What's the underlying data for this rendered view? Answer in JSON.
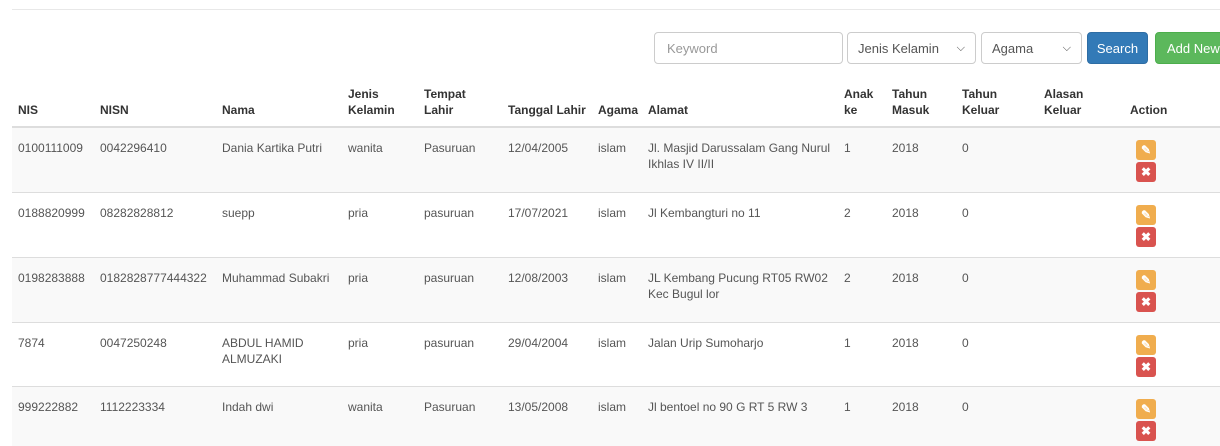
{
  "toolbar": {
    "keyword_placeholder": "Keyword",
    "jenis_kelamin_label": "Jenis Kelamin",
    "agama_label": "Agama",
    "search_label": "Search",
    "add_new_label": "Add New"
  },
  "table": {
    "headers": [
      "NIS",
      "NISN",
      "Nama",
      "Jenis Kelamin",
      "Tempat Lahir",
      "Tanggal Lahir",
      "Agama",
      "Alamat",
      "Anak ke",
      "Tahun Masuk",
      "Tahun Keluar",
      "Alasan Keluar",
      "Action"
    ],
    "rows": [
      {
        "nis": "0100111009",
        "nisn": "0042296410",
        "nama": "Dania Kartika Putri",
        "jk": "wanita",
        "tempat": "Pasuruan",
        "tanggal": "12/04/2005",
        "agama": "islam",
        "alamat": "Jl. Masjid Darussalam Gang Nurul Ikhlas IV II/II",
        "anak": "1",
        "masuk": "2018",
        "keluar": "0",
        "alasan": ""
      },
      {
        "nis": "0188820999",
        "nisn": "08282828812",
        "nama": "suepp",
        "jk": "pria",
        "tempat": "pasuruan",
        "tanggal": "17/07/2021",
        "agama": "islam",
        "alamat": "Jl Kembangturi no 11",
        "anak": "2",
        "masuk": "2018",
        "keluar": "0",
        "alasan": ""
      },
      {
        "nis": "0198283888",
        "nisn": "0182828777444322",
        "nama": "Muhammad Subakri",
        "jk": "pria",
        "tempat": "pasuruan",
        "tanggal": "12/08/2003",
        "agama": "islam",
        "alamat": "JL Kembang Pucung RT05 RW02 Kec Bugul lor",
        "anak": "2",
        "masuk": "2018",
        "keluar": "0",
        "alasan": ""
      },
      {
        "nis": "7874",
        "nisn": "0047250248",
        "nama": "ABDUL HAMID ALMUZAKI",
        "jk": "pria",
        "tempat": "pasuruan",
        "tanggal": "29/04/2004",
        "agama": "islam",
        "alamat": "Jalan Urip Sumoharjo",
        "anak": "1",
        "masuk": "2018",
        "keluar": "0",
        "alasan": ""
      },
      {
        "nis": "999222882",
        "nisn": "1112223334",
        "nama": "Indah dwi",
        "jk": "wanita",
        "tempat": "Pasuruan",
        "tanggal": "13/05/2008",
        "agama": "islam",
        "alamat": "Jl bentoel no 90 G RT 5 RW 3",
        "anak": "1",
        "masuk": "2018",
        "keluar": "0",
        "alasan": ""
      }
    ]
  },
  "icons": {
    "edit": "edit-icon",
    "delete": "delete-icon",
    "chevron": "chevron-down-icon"
  },
  "colors": {
    "search": "#337ab7",
    "add_new": "#5cb85c",
    "edit": "#f0ad4e",
    "delete": "#d9534f"
  }
}
